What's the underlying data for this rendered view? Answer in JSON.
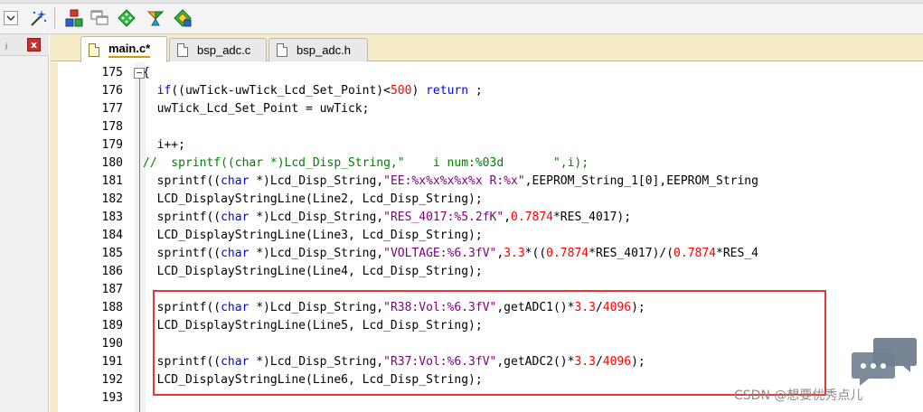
{
  "toolbar": {
    "buttons": [
      {
        "name": "dropdown-arrow-icon"
      },
      {
        "name": "magic-wand-icon"
      },
      {
        "name": "build-target-icon"
      },
      {
        "name": "windows-icon"
      },
      {
        "name": "green-diamond-icon"
      },
      {
        "name": "manage-components-icon"
      },
      {
        "name": "select-software-packs-icon"
      }
    ]
  },
  "panel": {
    "pin_icon": "ⱼ",
    "close_label": "x"
  },
  "tabs": [
    {
      "label": "main.c*",
      "active": true
    },
    {
      "label": "bsp_adc.c",
      "active": false
    },
    {
      "label": "bsp_adc.h",
      "active": false
    }
  ],
  "editor": {
    "fold_marker": "−",
    "lines": [
      {
        "n": "175",
        "tokens": [
          [
            "op",
            "{"
          ]
        ]
      },
      {
        "n": "176",
        "tokens": [
          [
            "op",
            "  "
          ],
          [
            "kw",
            "if"
          ],
          [
            "op",
            "((uwTick-uwTick_Lcd_Set_Point)<"
          ],
          [
            "num",
            "500"
          ],
          [
            "op",
            ") "
          ],
          [
            "kw",
            "return"
          ],
          [
            "op",
            " ;"
          ]
        ]
      },
      {
        "n": "177",
        "tokens": [
          [
            "op",
            "  uwTick_Lcd_Set_Point = uwTick;"
          ]
        ]
      },
      {
        "n": "178",
        "tokens": []
      },
      {
        "n": "179",
        "tokens": [
          [
            "op",
            "  i++;"
          ]
        ]
      },
      {
        "n": "180",
        "tokens": [
          [
            "cmt",
            "//  sprintf((char *)Lcd_Disp_String,\"    i num:%03d       \",i);"
          ]
        ]
      },
      {
        "n": "181",
        "tokens": [
          [
            "op",
            "  sprintf(("
          ],
          [
            "kw",
            "char"
          ],
          [
            "op",
            " *)Lcd_Disp_String,"
          ],
          [
            "str",
            "\"EE:%x%x%x%x%x R:%x\""
          ],
          [
            "op",
            ",EEPROM_String_1[0],EEPROM_String"
          ]
        ]
      },
      {
        "n": "182",
        "tokens": [
          [
            "op",
            "  LCD_DisplayStringLine(Line2, Lcd_Disp_String);"
          ]
        ]
      },
      {
        "n": "183",
        "tokens": [
          [
            "op",
            "  sprintf(("
          ],
          [
            "kw",
            "char"
          ],
          [
            "op",
            " *)Lcd_Disp_String,"
          ],
          [
            "str",
            "\"RES_4017:%5.2fK\""
          ],
          [
            "op",
            ","
          ],
          [
            "num",
            "0.7874"
          ],
          [
            "op",
            "*RES_4017);"
          ]
        ]
      },
      {
        "n": "184",
        "tokens": [
          [
            "op",
            "  LCD_DisplayStringLine(Line3, Lcd_Disp_String);"
          ]
        ]
      },
      {
        "n": "185",
        "tokens": [
          [
            "op",
            "  sprintf(("
          ],
          [
            "kw",
            "char"
          ],
          [
            "op",
            " *)Lcd_Disp_String,"
          ],
          [
            "str",
            "\"VOLTAGE:%6.3fV\""
          ],
          [
            "op",
            ","
          ],
          [
            "num",
            "3.3"
          ],
          [
            "op",
            "*(("
          ],
          [
            "num",
            "0.7874"
          ],
          [
            "op",
            "*RES_4017)/("
          ],
          [
            "num",
            "0.7874"
          ],
          [
            "op",
            "*RES_4"
          ]
        ]
      },
      {
        "n": "186",
        "tokens": [
          [
            "op",
            "  LCD_DisplayStringLine(Line4, Lcd_Disp_String);"
          ]
        ]
      },
      {
        "n": "187",
        "tokens": []
      },
      {
        "n": "188",
        "tokens": [
          [
            "op",
            "  sprintf(("
          ],
          [
            "kw",
            "char"
          ],
          [
            "op",
            " *)Lcd_Disp_String,"
          ],
          [
            "str",
            "\"R38:Vol:%6.3fV\""
          ],
          [
            "op",
            ",getADC1()*"
          ],
          [
            "num",
            "3.3"
          ],
          [
            "op",
            "/"
          ],
          [
            "num",
            "4096"
          ],
          [
            "op",
            ");"
          ]
        ]
      },
      {
        "n": "189",
        "tokens": [
          [
            "op",
            "  LCD_DisplayStringLine(Line5, Lcd_Disp_String);"
          ]
        ]
      },
      {
        "n": "190",
        "tokens": []
      },
      {
        "n": "191",
        "tokens": [
          [
            "op",
            "  sprintf(("
          ],
          [
            "kw",
            "char"
          ],
          [
            "op",
            " *)Lcd_Disp_String,"
          ],
          [
            "str",
            "\"R37:Vol:%6.3fV\""
          ],
          [
            "op",
            ",getADC2()*"
          ],
          [
            "num",
            "3.3"
          ],
          [
            "op",
            "/"
          ],
          [
            "num",
            "4096"
          ],
          [
            "op",
            ");"
          ]
        ]
      },
      {
        "n": "192",
        "tokens": [
          [
            "op",
            "  LCD_DisplayStringLine(Line6, Lcd_Disp_String);"
          ]
        ]
      },
      {
        "n": "193",
        "tokens": []
      }
    ]
  },
  "colors": {
    "keyword": "#0000ff",
    "number": "#ff0000",
    "string": "#800080",
    "comment": "#008000",
    "highlight_box": "#e53935"
  },
  "watermark": {
    "text": "CSDN @想要优秀点儿",
    "icon": "chat-bubble-icon"
  }
}
